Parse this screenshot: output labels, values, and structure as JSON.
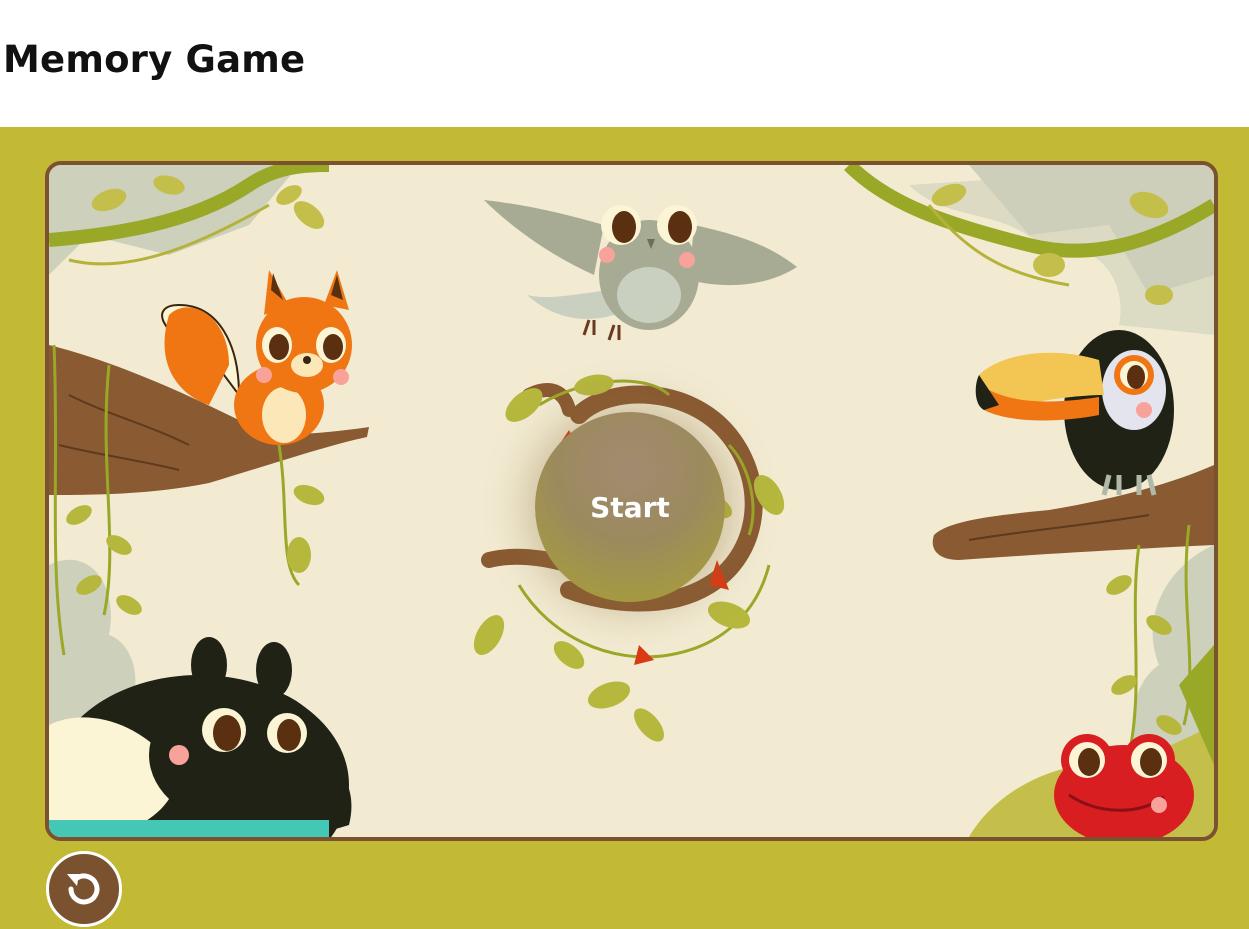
{
  "page": {
    "title": "Memory Game"
  },
  "game": {
    "start_label": "Start",
    "restart_icon": "restart-icon",
    "colors": {
      "frame": "#c2b934",
      "board_border": "#7a5230",
      "board_background": "#f2ebd2",
      "button_brown": "#7a5230"
    },
    "illustrations": [
      "squirrel",
      "owl",
      "toucan",
      "tapir",
      "frog",
      "vines",
      "branches"
    ]
  }
}
